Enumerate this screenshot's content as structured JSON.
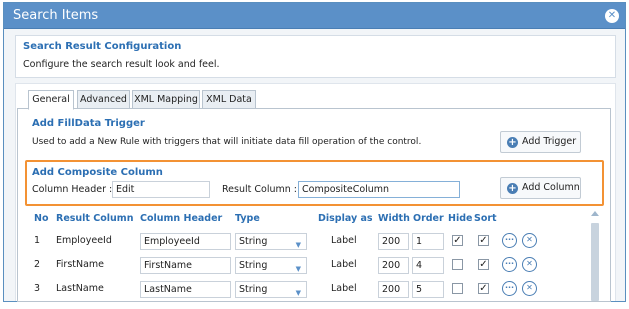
{
  "window": {
    "title": "Search Items"
  },
  "config": {
    "heading": "Search Result Configuration",
    "description": "Configure the search result look and feel."
  },
  "tabs": [
    "General",
    "Advanced",
    "XML Mapping",
    "XML Data"
  ],
  "filldata": {
    "heading": "Add FillData Trigger",
    "description": "Used to add a New Rule with triggers that will initiate data fill operation of the control.",
    "button_label": "Add Trigger"
  },
  "composite": {
    "heading": "Add Composite Column",
    "column_header_label": "Column Header :",
    "column_header_value": "Edit",
    "result_column_label": "Result Column :",
    "result_column_value": "CompositeColumn",
    "button_label": "Add Column"
  },
  "table": {
    "headers": [
      "No",
      "Result Column",
      "Column Header",
      "Type",
      "Display as",
      "Width",
      "Order",
      "Hide",
      "Sort"
    ],
    "rows": [
      {
        "no": "1",
        "result_column": "EmployeeId",
        "column_header": "EmployeeId",
        "type": "String",
        "display_as": "Label",
        "width": "200",
        "order": "1",
        "hide": true,
        "sort": true
      },
      {
        "no": "2",
        "result_column": "FirstName",
        "column_header": "FirstName",
        "type": "String",
        "display_as": "Label",
        "width": "200",
        "order": "4",
        "hide": false,
        "sort": true
      },
      {
        "no": "3",
        "result_column": "LastName",
        "column_header": "LastName",
        "type": "String",
        "display_as": "Label",
        "width": "200",
        "order": "5",
        "hide": false,
        "sort": true
      }
    ]
  },
  "icons": {
    "close": "close-icon",
    "add": "plus-circle-icon",
    "more": "ellipsis-circle-icon",
    "settings": "tools-circle-icon",
    "dropdown": "chevron-down-icon"
  },
  "colors": {
    "titlebar": "#5b90c8",
    "accent": "#2c6fb3",
    "highlight": "#f39234"
  }
}
